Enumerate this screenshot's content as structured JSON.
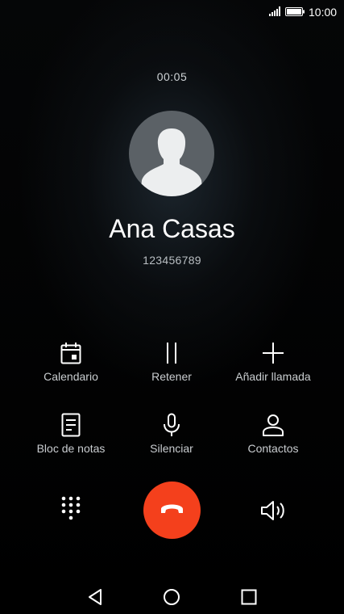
{
  "status_bar": {
    "time": "10:00"
  },
  "call": {
    "timer": "00:05",
    "contact_name": "Ana Casas",
    "contact_number": "123456789"
  },
  "actions": [
    {
      "label": "Calendario",
      "icon": "calendar-icon"
    },
    {
      "label": "Retener",
      "icon": "pause-icon"
    },
    {
      "label": "Añadir llamada",
      "icon": "plus-icon"
    },
    {
      "label": "Bloc de notas",
      "icon": "notepad-icon"
    },
    {
      "label": "Silenciar",
      "icon": "microphone-icon"
    },
    {
      "label": "Contactos",
      "icon": "person-icon"
    }
  ],
  "bottom_controls": {
    "dialpad_icon": "dialpad-icon",
    "end_call_icon": "hang-up-icon",
    "speaker_icon": "speaker-icon"
  },
  "navigation": {
    "back_icon": "back-triangle-icon",
    "home_icon": "home-circle-icon",
    "recents_icon": "recents-square-icon"
  },
  "colors": {
    "end_call": "#f4401c",
    "background": "#000000",
    "text_primary": "#ffffff",
    "text_secondary": "#c9cdd0"
  }
}
